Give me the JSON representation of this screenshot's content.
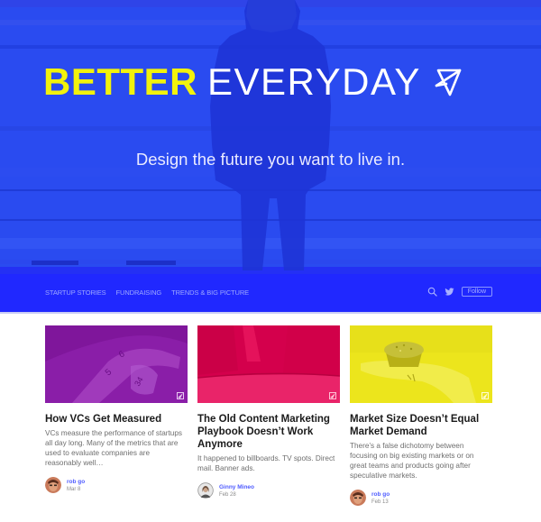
{
  "hero": {
    "title_bold": "BETTER",
    "title_light": "EVERYDAY",
    "logo_icon": "paper-plane-icon",
    "subtitle": "Design the future you want to live in.",
    "colors": {
      "background": "#2a4bf0",
      "title_bold": "#f2f20c",
      "title_light": "#ffffff"
    }
  },
  "nav": {
    "links": [
      {
        "label": "STARTUP STORIES"
      },
      {
        "label": "FUNDRAISING"
      },
      {
        "label": "TRENDS & BIG PICTURE"
      }
    ],
    "search_icon": "search-icon",
    "twitter_icon": "twitter-icon",
    "follow_label": "Follow",
    "colors": {
      "background": "#2028ff",
      "link": "#9da8ff"
    }
  },
  "cards": [
    {
      "image_tint": "#8a1ea8",
      "title": "How VCs Get Measured",
      "excerpt": "VCs measure the performance of startups all day long. Many of the metrics that are used to evaluate companies are reasonably well…",
      "author": "rob go",
      "date": "Mar 8"
    },
    {
      "image_tint": "#e0004f",
      "title": "The Old Content Marketing Playbook Doesn’t Work Anymore",
      "excerpt": "It happened to billboards. TV spots. Direct mail. Banner ads.",
      "author": "Ginny Mineo",
      "date": "Feb 28"
    },
    {
      "image_tint": "#ece51c",
      "title": "Market Size Doesn’t Equal Market Demand",
      "excerpt": "There’s a false dichotomy between focusing on big existing markets or on great teams and products going after speculative markets.",
      "author": "rob go",
      "date": "Feb 13"
    }
  ],
  "accent_colors": {
    "author_link": "#4f5cff",
    "text_muted": "#6e6e6e"
  }
}
